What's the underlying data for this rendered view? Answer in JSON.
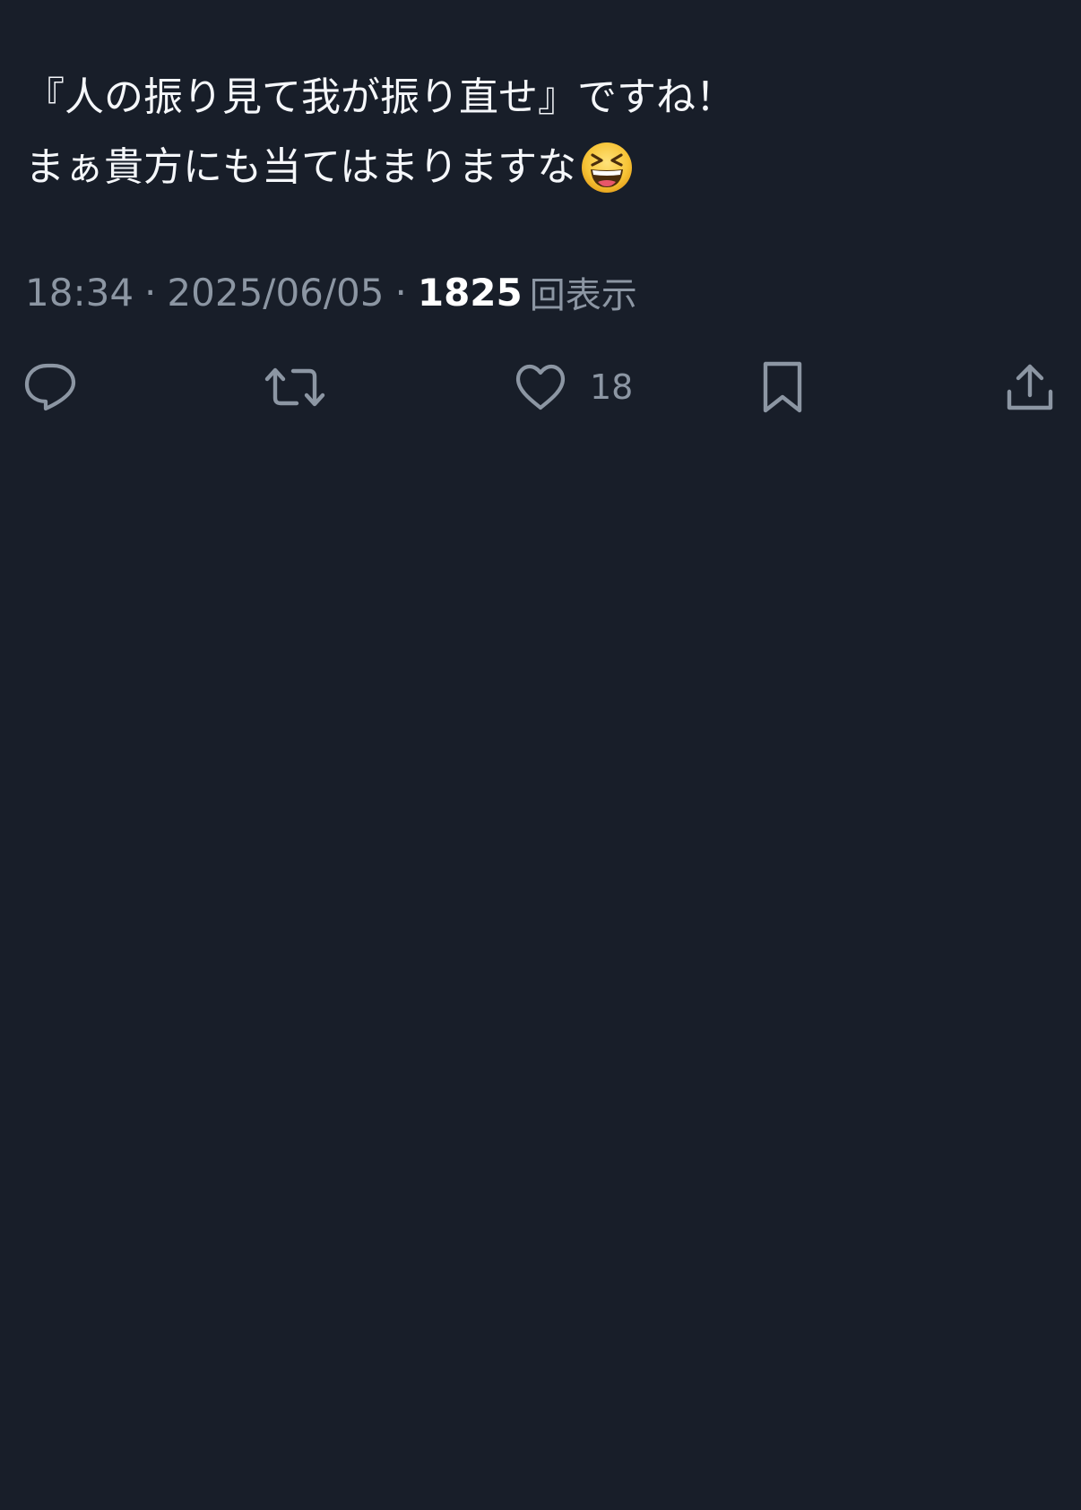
{
  "tweet": {
    "line1": "『人の振り見て我が振り直せ』ですね！",
    "line2": "まぁ貴方にも当てはまりますな",
    "emoji": "grinning-squinting-face-icon"
  },
  "meta": {
    "time": "18:34",
    "separator": "·",
    "date": "2025/06/05",
    "views_count": "1825",
    "views_label": "回表示"
  },
  "actions": {
    "reply_icon": "reply-icon",
    "retweet_icon": "retweet-icon",
    "like_icon": "heart-icon",
    "like_count": "18",
    "bookmark_icon": "bookmark-icon",
    "share_icon": "share-icon"
  },
  "colors": {
    "background": "#181e29",
    "text": "#f5f7fa",
    "muted": "#8c96a3"
  }
}
